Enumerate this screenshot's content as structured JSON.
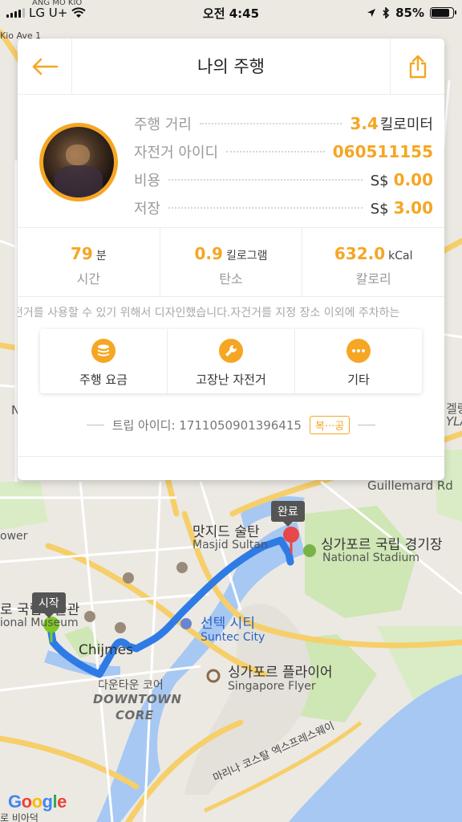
{
  "status_bar": {
    "carrier": "LG U+",
    "time": "오전 4:45",
    "battery": "85%",
    "battery_level": 0.85,
    "icons": [
      "signal-icon",
      "wifi-icon",
      "location-arrow-icon",
      "bluetooth-icon",
      "battery-icon"
    ]
  },
  "header": {
    "title": "나의 주행",
    "back_icon": "arrow-left-icon",
    "share_icon": "share-icon"
  },
  "summary": {
    "rows": [
      {
        "label": "주행 거리",
        "prefix": "",
        "value": "3.4",
        "unit": "킬로미터"
      },
      {
        "label": "자전거 아이디",
        "prefix": "",
        "value": "060511155",
        "unit": ""
      },
      {
        "label": "비용",
        "prefix": "S$",
        "value": "0.00",
        "unit": ""
      },
      {
        "label": "저장",
        "prefix": "S$",
        "value": "3.00",
        "unit": ""
      }
    ]
  },
  "stats": [
    {
      "value": "79",
      "unit": "분",
      "label": "시간"
    },
    {
      "value": "0.9",
      "unit": "킬로그램",
      "label": "탄소"
    },
    {
      "value": "632.0",
      "unit": "kCal",
      "label": "칼로리"
    }
  ],
  "notice": "전거를 사용할 수 있기 위해서 디자인했습니다.자건거를 지정 장소 이외에 주차하는",
  "actions": [
    {
      "label": "주행 요금",
      "icon": "coins-icon"
    },
    {
      "label": "고장난 자전거",
      "icon": "wrench-icon"
    },
    {
      "label": "기타",
      "icon": "more-icon"
    }
  ],
  "trip": {
    "label": "트립 아이디: 1711050901396415",
    "copy": "복···공"
  },
  "map": {
    "labels": {
      "ang_mo_kio": "ANG MO KIO",
      "kio_ave": "Kio Ave 1",
      "guillemard": "Guillemard Rd",
      "masjid_ko": "맛지드 술탄",
      "masjid_en": "Masjid Sultan",
      "stadium_ko": "싱가포르 국립 경기장",
      "stadium_en": "National Stadium",
      "suntec_ko": "선텍 시티",
      "suntec_en": "Suntec City",
      "chijmes": "Chijmes",
      "downtown_ko": "다운타운 코어",
      "downtown_en1": "DOWNTOWN",
      "downtown_en2": "CORE",
      "flyer_ko": "싱가포르 플라이어",
      "flyer_en": "Singapore Flyer",
      "museum_ko": "로 국립박물관",
      "museum_en": "ional Museum",
      "tower": "ower",
      "expressway": "마리나 코스탈 엑스프레스웨이",
      "bottom_left": "로 비아덕",
      "side_n": "N",
      "side_gel": "겔랑",
      "side_yla": "YLA",
      "start_tag": "시작",
      "end_tag": "완료"
    },
    "colors": {
      "route": "#2f7be5",
      "start": "#7ec820",
      "end": "#e8474b",
      "water": "#a6c8f3",
      "park": "#cfe6b5",
      "road": "#f6cf6a"
    }
  },
  "google_logo": [
    "G",
    "o",
    "o",
    "g",
    "l",
    "e"
  ],
  "colors": {
    "accent": "#f5a623"
  }
}
